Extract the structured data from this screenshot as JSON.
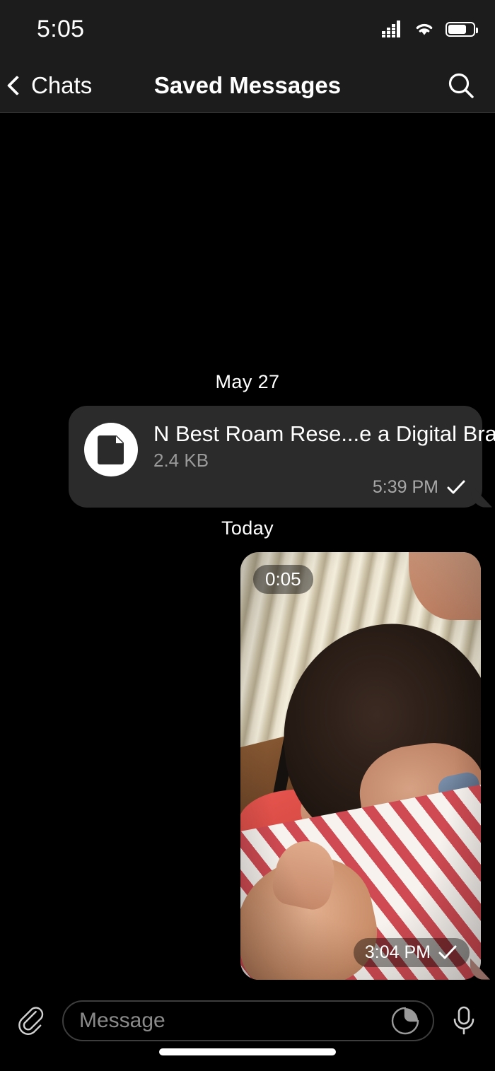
{
  "status_bar": {
    "time": "5:05",
    "signal_icon": "cellular-signal-icon",
    "wifi_icon": "wifi-icon",
    "battery_icon": "battery-icon",
    "battery_level": 74
  },
  "nav": {
    "back_label": "Chats",
    "back_icon": "chevron-left-icon",
    "title": "Saved Messages",
    "search_icon": "search-icon"
  },
  "chat": {
    "date_separators": {
      "first": "May 27",
      "second": "Today"
    },
    "messages": [
      {
        "type": "file",
        "file_icon": "document-icon",
        "file_name": "N Best Roam Rese...e a Digital Brain.txt",
        "file_size": "2.4 KB",
        "time": "5:39 PM",
        "status_icon": "sent-check-icon"
      },
      {
        "type": "video",
        "duration": "0:05",
        "time": "3:04 PM",
        "status_icon": "sent-check-icon"
      }
    ]
  },
  "input_bar": {
    "attach_icon": "paperclip-icon",
    "placeholder": "Message",
    "sticker_icon": "sticker-icon",
    "mic_icon": "microphone-icon"
  },
  "colors": {
    "header_bg": "#1c1c1c",
    "chat_bg": "#000000",
    "bubble_bg": "#2b2b2b",
    "text_primary": "#ffffff",
    "text_secondary": "#9a9a9a"
  }
}
